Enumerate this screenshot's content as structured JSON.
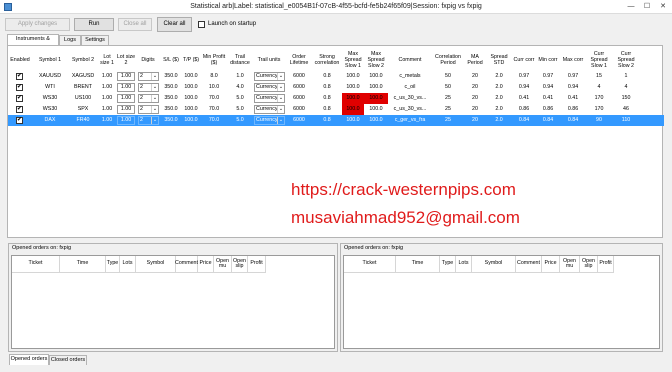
{
  "window": {
    "title": "Statistical arb|Label: statistical_e0054B1f-07cB-4f55-bcfd-fe5b24f65f09|Session: fxpig vs fxpig",
    "min_glyph": "—",
    "max_glyph": "☐",
    "close_glyph": "✕"
  },
  "toolbar": {
    "apply_label": "Apply changes",
    "run_label": "Run",
    "close_all_label": "Close all",
    "clear_all_label": "Clear all",
    "launch_label": "Launch on startup"
  },
  "tabs": [
    "Instruments & Orders",
    "Logs",
    "Settings"
  ],
  "grid": {
    "headers": [
      "Enabled",
      "Symbol 1",
      "Symbol 2",
      "Lot size 1",
      "Lot size 2",
      "Digits",
      "S/L ($)",
      "T/P ($)",
      "Min Profit ($)",
      "Trail distance",
      "Trail units",
      "Order Lifetime",
      "Strong correlation",
      "Max Spread Slow 1",
      "Max Spread Slow 2",
      "Comment",
      "Correlation Period",
      "MA Period",
      "Spread STD",
      "Curr corr",
      "Min corr",
      "Max corr",
      "Curr Spread Slow 1",
      "Curr Spread Slow 2"
    ],
    "rows": [
      {
        "enabled": "✔",
        "sym1": "XAUUSD",
        "sym2": "XAGUSD",
        "lot1": "1.00",
        "lot2": "1.00",
        "digits": "2",
        "sl": "350.0",
        "tp": "100.0",
        "minprofit": "8.0",
        "trail": "1.0",
        "units": "Currency",
        "lifetime": "6000",
        "strong": "0.8",
        "ms1": "100.0",
        "ms2": "100.0",
        "comment": "c_metals",
        "corrp": "50",
        "map": "20",
        "std": "2.0",
        "curr": "0.97",
        "min": "0.97",
        "max": "0.97",
        "cs1": "15",
        "cs2": "1"
      },
      {
        "enabled": "✔",
        "sym1": "WTI",
        "sym2": "BRENT",
        "lot1": "1.00",
        "lot2": "1.00",
        "digits": "2",
        "sl": "350.0",
        "tp": "100.0",
        "minprofit": "10.0",
        "trail": "4.0",
        "units": "Currency",
        "lifetime": "6000",
        "strong": "0.8",
        "ms1": "100.0",
        "ms2": "100.0",
        "comment": "c_oil",
        "corrp": "50",
        "map": "20",
        "std": "2.0",
        "curr": "0.94",
        "min": "0.94",
        "max": "0.94",
        "cs1": "4",
        "cs2": "4"
      },
      {
        "enabled": "✔",
        "sym1": "WS30",
        "sym2": "US100",
        "lot1": "1.00",
        "lot2": "1.00",
        "digits": "2",
        "sl": "350.0",
        "tp": "100.0",
        "minprofit": "70.0",
        "trail": "5.0",
        "units": "Currency",
        "lifetime": "6000",
        "strong": "0.8",
        "ms1": "100.0",
        "ms2": "100.0",
        "comment": "c_us_30_vs...",
        "corrp": "25",
        "map": "20",
        "std": "2.0",
        "curr": "0.41",
        "min": "0.41",
        "max": "0.41",
        "cs1": "170",
        "cs2": "150"
      },
      {
        "enabled": "✔",
        "sym1": "WS30",
        "sym2": "SPX",
        "lot1": "1.00",
        "lot2": "1.00",
        "digits": "2",
        "sl": "350.0",
        "tp": "100.0",
        "minprofit": "70.0",
        "trail": "5.0",
        "units": "Currency",
        "lifetime": "6000",
        "strong": "0.8",
        "ms1": "100.0",
        "ms2": "100.0",
        "comment": "c_us_30_vs...",
        "corrp": "25",
        "map": "20",
        "std": "2.0",
        "curr": "0.86",
        "min": "0.86",
        "max": "0.86",
        "cs1": "170",
        "cs2": "46"
      },
      {
        "enabled": "✔",
        "sym1": "DAX",
        "sym2": "FR40",
        "lot1": "1.00",
        "lot2": "1.00",
        "digits": "2",
        "sl": "350.0",
        "tp": "100.0",
        "minprofit": "70.0",
        "trail": "5.0",
        "units": "Currency",
        "lifetime": "6000",
        "strong": "0.8",
        "ms1": "100.0",
        "ms2": "100.0",
        "comment": "c_ger_vs_fra",
        "corrp": "25",
        "map": "20",
        "std": "2.0",
        "curr": "0.84",
        "min": "0.84",
        "max": "0.84",
        "cs1": "90",
        "cs2": "110"
      }
    ],
    "highlight_color": "#e00000",
    "selection_color": "#3399ff"
  },
  "watermark": {
    "line1": "https://crack-westernpips.com",
    "line2": "musaviahmad952@gmail.com",
    "color": "#e01b1b"
  },
  "orders": {
    "left_label": "Opened orders on: fxpig",
    "right_label": "Opened orders on: fxpig",
    "columns": [
      "Ticket",
      "Time",
      "Type",
      "Lots",
      "Symbol",
      "Comment",
      "Price",
      "Open mu",
      "Open slip",
      "Profit"
    ]
  },
  "bottom_tabs": [
    "Opened orders",
    "Closed orders"
  ]
}
